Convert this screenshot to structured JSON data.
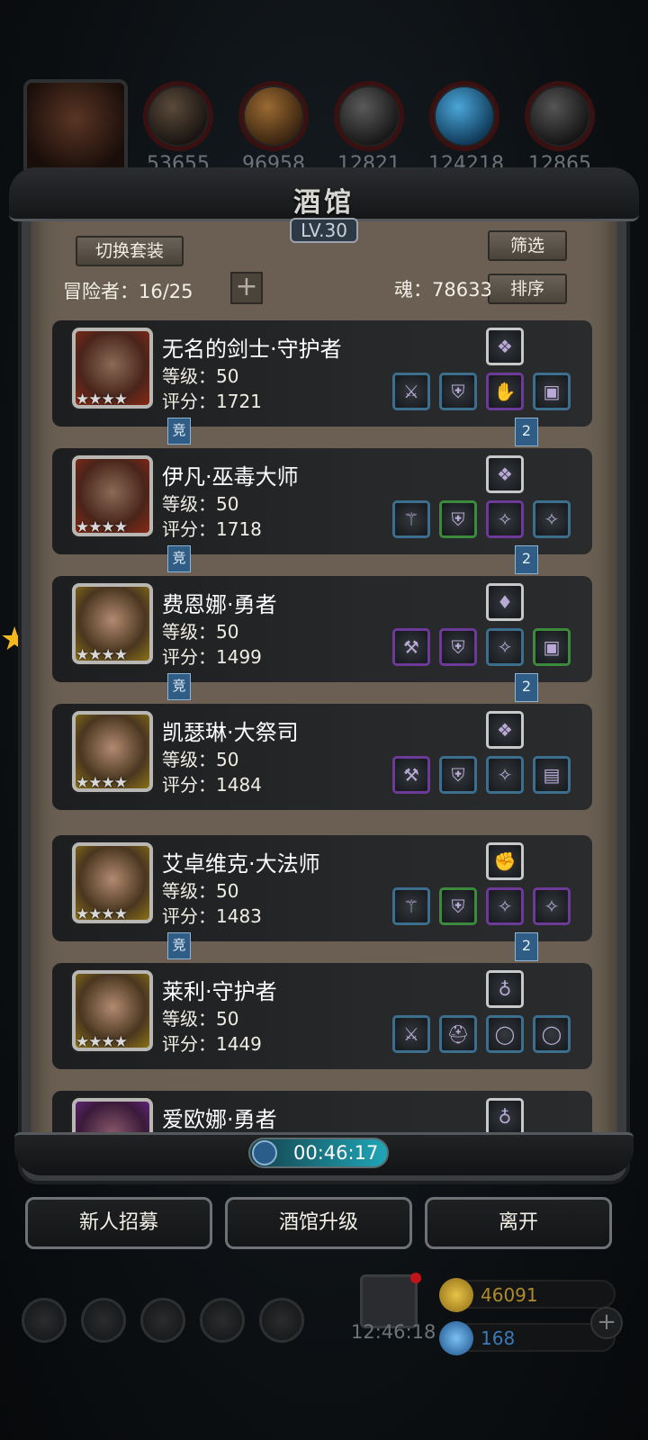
{
  "header": {
    "resources": [
      {
        "name": "meat-icon",
        "value": "53655"
      },
      {
        "name": "wood-icon",
        "value": "96958"
      },
      {
        "name": "iron-icon",
        "value": "12821"
      },
      {
        "name": "crystal-icon",
        "value": "124218"
      },
      {
        "name": "stone-icon",
        "value": "12865"
      }
    ]
  },
  "tavern": {
    "title": "酒馆",
    "level": "LV.30",
    "switch_outfit": "切换套装",
    "filter": "筛选",
    "sort": "排序",
    "adventurers_label": "冒险者：16/25",
    "soul_label": "魂：78633"
  },
  "heroes": [
    {
      "name": "无名的剑士·守护者",
      "level": "等级：50",
      "score": "评分：1721",
      "stars": "★★★★",
      "frame": "red",
      "top_item": "crystal-icon",
      "items": [
        [
          "sword-icon",
          "o"
        ],
        [
          "armor-icon",
          "o"
        ],
        [
          "gauntlet-icon",
          "p"
        ],
        [
          "chest-icon",
          "o"
        ]
      ],
      "jing": "竞",
      "badge": "2"
    },
    {
      "name": "伊凡·巫毒大师",
      "level": "等级：50",
      "score": "评分：1718",
      "stars": "★★★★",
      "frame": "red",
      "top_item": "crystal-icon",
      "items": [
        [
          "staff-icon",
          "o"
        ],
        [
          "armor-icon",
          "g"
        ],
        [
          "amulet-icon",
          "p"
        ],
        [
          "amulet-icon",
          "o"
        ]
      ],
      "jing": "竞",
      "badge": "2"
    },
    {
      "name": "费恩娜·勇者",
      "level": "等级：50",
      "score": "评分：1499",
      "stars": "★★★★",
      "frame": "gold",
      "top_item": "gem-icon",
      "items": [
        [
          "axe-icon",
          "p"
        ],
        [
          "armor-icon",
          "p"
        ],
        [
          "amulet-icon",
          "o"
        ],
        [
          "chest-icon",
          "g"
        ]
      ],
      "jing": "竞",
      "badge": "2"
    },
    {
      "name": "凯瑟琳·大祭司",
      "level": "等级：50",
      "score": "评分：1484",
      "stars": "★★★★",
      "frame": "gold",
      "top_item": "crystal-icon",
      "items": [
        [
          "hammer-icon",
          "p"
        ],
        [
          "armor-icon",
          "o"
        ],
        [
          "amulet-icon",
          "o"
        ],
        [
          "scroll-icon",
          "o"
        ]
      ],
      "jing": "",
      "badge": ""
    },
    {
      "name": "艾卓维克·大法师",
      "level": "等级：50",
      "score": "评分：1483",
      "stars": "★★★★",
      "frame": "gold",
      "top_item": "glove-icon",
      "items": [
        [
          "staff-icon",
          "o"
        ],
        [
          "armor-icon",
          "g"
        ],
        [
          "amulet-icon",
          "p"
        ],
        [
          "amulet-icon",
          "p"
        ]
      ],
      "jing": "竞",
      "badge": "2"
    },
    {
      "name": "莱利·守护者",
      "level": "等级：50",
      "score": "评分：1449",
      "stars": "★★★★",
      "frame": "gold",
      "top_item": "necklace-icon",
      "items": [
        [
          "sword-icon",
          "o"
        ],
        [
          "helmet-icon",
          "o"
        ],
        [
          "ring-icon",
          "o"
        ],
        [
          "ring-icon",
          "o"
        ]
      ],
      "jing": "",
      "badge": ""
    },
    {
      "name": "爱欧娜·勇者",
      "level": "",
      "score": "",
      "stars": "",
      "frame": "purple",
      "top_item": "necklace-icon",
      "items": [],
      "jing": "",
      "badge": ""
    }
  ],
  "timer": "00:46:17",
  "actions": {
    "recruit": "新人招募",
    "upgrade": "酒馆升级",
    "leave": "离开"
  },
  "footer": {
    "gold": "46091",
    "gems": "168",
    "clock": "12:46:18"
  }
}
